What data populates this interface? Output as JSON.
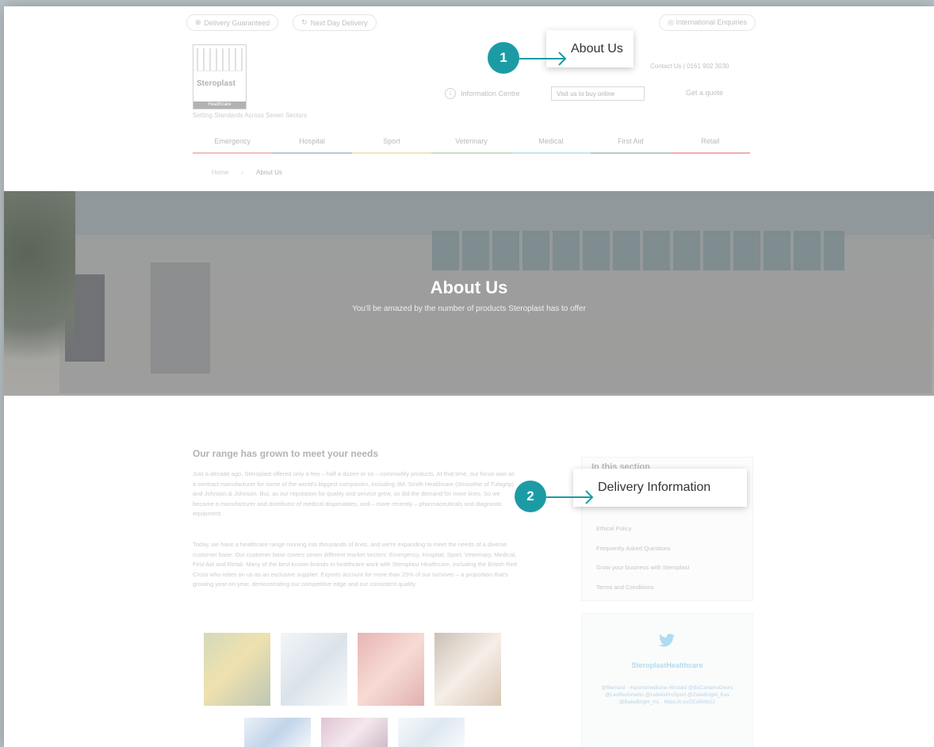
{
  "utility": {
    "delivery_guarantee": "Delivery Guaranteed",
    "next_day": "Next Day Delivery",
    "international": "International Enquiries"
  },
  "logo": {
    "brand": "Steroplast",
    "sub": "Healthcare"
  },
  "tagline": "Setting Standards Across Seven Sectors",
  "contact": "Contact Us  |  0161 902 3030",
  "header": {
    "information_centre": "Information Centre",
    "buy_online": "Visit us to buy online",
    "get_quote": "Get a quote"
  },
  "nav": {
    "items": [
      {
        "label": "Emergency",
        "color": "#d9534f"
      },
      {
        "label": "Hospital",
        "color": "#337ab7"
      },
      {
        "label": "Sport",
        "color": "#f0ad4e"
      },
      {
        "label": "Veterinary",
        "color": "#5cb85c"
      },
      {
        "label": "Medical",
        "color": "#5bc0de"
      },
      {
        "label": "First Aid",
        "color": "#2e8b57"
      },
      {
        "label": "Retail",
        "color": "#c9302c"
      }
    ]
  },
  "breadcrumb": {
    "home": "Home",
    "current": "About Us"
  },
  "hero": {
    "title": "About Us",
    "subtitle": "You'll be amazed by the number of products Steroplast has to offer"
  },
  "content": {
    "heading": "Our range has grown to meet your needs",
    "para1": "Just a decade ago, Steroplast offered only a few – half a dozen or so – commodity products. At that time, our focus was as a contract manufacturer for some of the world's biggest companies, including 3M, Smith Healthcare (Smoothie of Tubigrip) and Johnson & Johnson. But, as our reputation for quality and service grew, so did the demand for more lines. So we became a manufacturer and distributor of medical disposables, and – more recently – pharmaceuticals and diagnostic equipment.",
    "para2": "Today, we have a healthcare range running into thousands of lines, and we're expanding to meet the needs of a diverse customer base. Our customer base covers seven different market sectors: Emergency, Hospital, Sport, Veterinary, Medical, First Aid and Retail. Many of the best known brands in healthcare work with Steroplast Healthcare, including the British Red Cross who relies on us as an exclusive supplier. Exports account for more than 25% of our turnover – a proportion that's growing year-on-year, demonstrating our competitive edge and our consistent quality."
  },
  "sidebar": {
    "title": "In this section",
    "links": [
      "Ethical Policy",
      "Frequently Asked Questions",
      "Grow your business with Steroplast",
      "Terms and Conditions"
    ]
  },
  "twitter": {
    "handle": "SteroplastHealthcare",
    "tweet": "@Bernard · #sportsmedicine #firstaid @BuCanamoDoors @LeoRechmetto @LebelxProSport @ZukeBright_Kas @BakeBright_mL · https://t.co/ZEo6Wb22"
  },
  "callouts": [
    {
      "number": "1",
      "label": "About Us"
    },
    {
      "number": "2",
      "label": "Delivery Information"
    }
  ],
  "colors": {
    "accent": "#1b9ca5",
    "twitter": "#2aa3d8"
  }
}
